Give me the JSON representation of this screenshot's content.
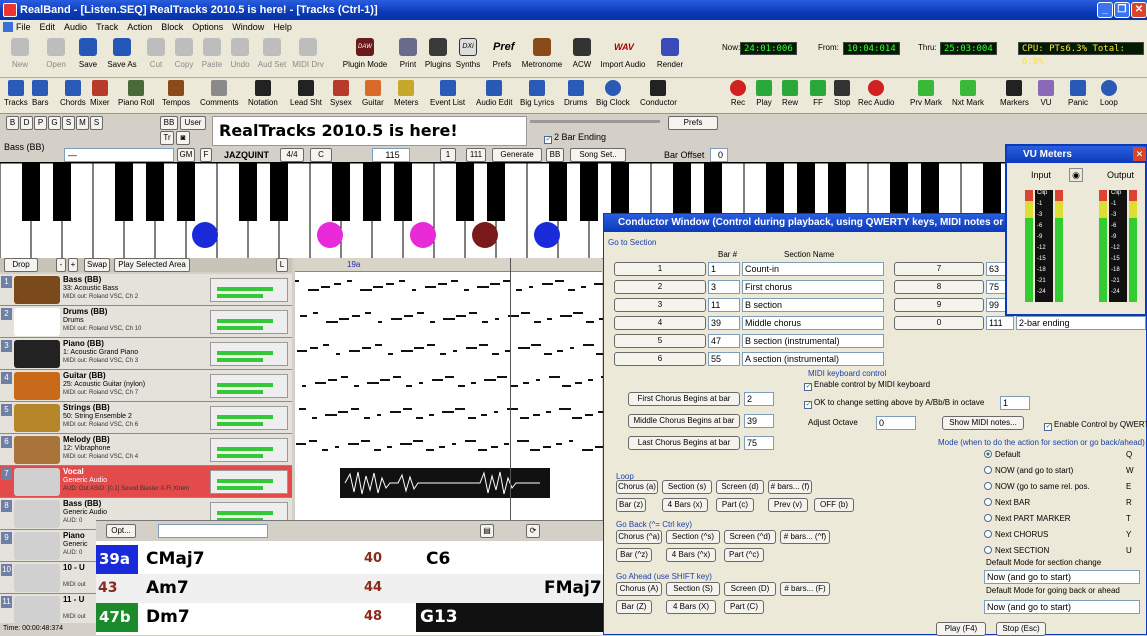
{
  "window": {
    "title": "RealBand - [Listen.SEQ]    RealTracks 2010.5 is here! - [Tracks (Ctrl-1)]"
  },
  "menu": [
    "File",
    "Edit",
    "Audio",
    "Track",
    "Action",
    "Block",
    "Options",
    "Window",
    "Help"
  ],
  "toolbar1": {
    "buttons": [
      "New",
      "Open",
      "Save",
      "Save As",
      "Cut",
      "Copy",
      "Paste",
      "Undo",
      "Aud Set",
      "MIDI Drv",
      "Plugin Mode",
      "Print",
      "Plugins",
      "Synths",
      "Prefs",
      "Metronome",
      "ACW",
      "Import Audio",
      "Render"
    ],
    "daw_badge": "DAW",
    "dx_badge": "DXi",
    "pref_text": "Pref",
    "wav_text": "WAV",
    "now_label": "Now:",
    "now_value": "24:01:006",
    "from_label": "From:",
    "from_value": "10:04:014",
    "thru_label": "Thru:",
    "thru_value": "25:03:004",
    "cpu": "CPU: PTs6.3% Total: 6.8%"
  },
  "toolbar2": {
    "buttons": [
      "Tracks",
      "Bars",
      "Chords",
      "Mixer",
      "Piano Roll",
      "Tempos",
      "Comments",
      "Notation",
      "Lead Sht",
      "Sysex",
      "Guitar",
      "Meters",
      "Event List",
      "Audio Edit",
      "Big Lyrics",
      "Drums",
      "Big Clock",
      "Conductor"
    ],
    "transport": [
      "Rec",
      "Play",
      "Rew",
      "FF",
      "Stop",
      "Rec Audio",
      "Prv Mark",
      "Nxt Mark",
      "Markers",
      "VU",
      "Panic",
      "Loop"
    ]
  },
  "upper": {
    "letter_buttons": [
      "B",
      "D",
      "P",
      "G",
      "S",
      "M",
      "S"
    ],
    "bb_btn": "BB",
    "user_btn": "User",
    "tr_btn": "Tr",
    "banner": "RealTracks 2010.5 is here!",
    "prefs_btn": "Prefs",
    "two_bar_ending": "2 Bar Ending",
    "bass_label": "Bass  (BB)",
    "gm_btn": "GM",
    "f_btn": "F",
    "style": "JAZQUINT",
    "timesig": "4/4",
    "key": "C",
    "tempo": "115",
    "start_bar": "1",
    "end_bar": "111",
    "generate_btn": "Generate",
    "bb_btn2": "BB",
    "song_set_btn": "Song Set..",
    "bar_offset_label": "Bar Offset",
    "bar_offset_value": "0"
  },
  "tracks_panel": {
    "drop_btn": "Drop",
    "swap_btn": "Swap",
    "play_area_btn": "Play Selected Area",
    "l_btn": "L",
    "bar_marker": "19a",
    "tracks": [
      {
        "num": "1",
        "name": "Bass   (BB)",
        "inst": "33: Acoustic Bass",
        "out": "MIDI out: Roland VSC, Ch 2"
      },
      {
        "num": "2",
        "name": "Drums  (BB)",
        "inst": "Drums",
        "out": "MIDI out: Roland VSC, Ch 10"
      },
      {
        "num": "3",
        "name": "Piano  (BB)",
        "inst": "1: Acoustic Grand Piano",
        "out": "MIDI out: Roland VSC, Ch 3"
      },
      {
        "num": "4",
        "name": "Guitar  (BB)",
        "inst": "25: Acoustic Guitar (nylon)",
        "out": "MIDI out: Roland VSC, Ch 7"
      },
      {
        "num": "5",
        "name": "Strings  (BB)",
        "inst": "50: String Ensemble 2",
        "out": "MIDI out: Roland VSC, Ch 6"
      },
      {
        "num": "6",
        "name": "Melody  (BB)",
        "inst": "12: Vibraphone",
        "out": "MIDI out: Roland VSC, Ch 4"
      },
      {
        "num": "7",
        "name": "Vocal",
        "inst": "Generic Audio",
        "out": "AUD: Out ASIO: [0,1] Sound Blaster X-Fi Xtrem"
      },
      {
        "num": "8",
        "name": "Bass   (BB)",
        "inst": "Generic Audio",
        "out": "AUD: 0"
      },
      {
        "num": "9",
        "name": "Piano",
        "inst": "Generic",
        "out": "AUD: 0"
      },
      {
        "num": "10",
        "name": "10 - U",
        "inst": "",
        "out": "MIDI out"
      },
      {
        "num": "11",
        "name": "11 - U",
        "inst": "",
        "out": "MIDI out"
      }
    ]
  },
  "chord_sheet": {
    "opt_btn": "Opt...",
    "rows": [
      {
        "bar1": "39a",
        "chord1": "CMaj7",
        "bar2": "40",
        "chord2": "C6",
        "extra": ""
      },
      {
        "bar1": "43",
        "chord1": "Am7",
        "bar2": "44",
        "chord2": "",
        "extra": "FMaj7"
      },
      {
        "bar1": "47b",
        "chord1": "Dm7",
        "bar2": "48",
        "chord2": "G13",
        "extra": ""
      }
    ]
  },
  "status": {
    "time": "Time: 00:00:48:374"
  },
  "conductor": {
    "title": "Conductor Window (Control during playback, using QWERTY keys, MIDI notes or buttons)",
    "goto_label": "Go to Section",
    "bar_header": "Bar #",
    "section_header": "Section Name",
    "sections_left": [
      {
        "btn": "1",
        "bar": "1",
        "name": "Count-in"
      },
      {
        "btn": "2",
        "bar": "3",
        "name": "First chorus"
      },
      {
        "btn": "3",
        "bar": "11",
        "name": "B section"
      },
      {
        "btn": "4",
        "bar": "39",
        "name": "Middle chorus"
      },
      {
        "btn": "5",
        "bar": "47",
        "name": "B section (instrumental)"
      },
      {
        "btn": "6",
        "bar": "55",
        "name": "A section (instrumental)"
      }
    ],
    "sections_right": [
      {
        "btn": "7",
        "bar": "63",
        "name": ""
      },
      {
        "btn": "8",
        "bar": "75",
        "name": ""
      },
      {
        "btn": "9",
        "bar": "99",
        "name": ""
      },
      {
        "btn": "0",
        "bar": "111",
        "name": "2-bar ending"
      }
    ],
    "first_chorus_btn": "First Chorus Begins at bar",
    "first_chorus_val": "2",
    "middle_chorus_btn": "Middle Chorus Begins at bar",
    "middle_chorus_val": "39",
    "last_chorus_btn": "Last Chorus Begins at bar",
    "last_chorus_val": "75",
    "midi_label": "MIDI keyboard control",
    "enable_midi": "Enable control by MIDI keyboard",
    "ok_change": "OK to change setting above by A/Bb/B in octave",
    "octave_val": "1",
    "adjust_octave": "Adjust Octave",
    "adjust_val": "0",
    "show_midi_btn": "Show MIDI notes...",
    "enable_qwerty": "Enable Control by QWERTY",
    "mode_label": "Mode (when to do the action for section or go back/ahead)",
    "modes": [
      {
        "label": "Default",
        "key": "Q",
        "selected": true
      },
      {
        "label": "NOW (and go to start)",
        "key": "W",
        "selected": false
      },
      {
        "label": "NOW (go to same rel. pos.",
        "key": "E",
        "selected": false
      },
      {
        "label": "Next BAR",
        "key": "R",
        "selected": false
      },
      {
        "label": "Next PART MARKER",
        "key": "T",
        "selected": false
      },
      {
        "label": "Next CHORUS",
        "key": "Y",
        "selected": false
      },
      {
        "label": "Next SECTION",
        "key": "U",
        "selected": false
      }
    ],
    "default_section_label": "Default Mode for section change",
    "default_section_val": "Now (and go to start)",
    "default_back_label": "Default Mode for going back or ahead",
    "default_back_val": "Now (and go to start)",
    "loop_label": "Loop",
    "loop_btns": [
      "Chorus (a)",
      "Section (s)",
      "Screen (d)",
      "# bars... (f)",
      "Bar (z)",
      "4 Bars (x)",
      "Part (c)",
      "Prev (v)",
      "OFF (b)"
    ],
    "goback_label": "Go Back  (^= Ctrl key)",
    "goback_btns": [
      "Chorus (^a)",
      "Section (^s)",
      "Screen (^d)",
      "# bars... (^f)",
      "Bar (^z)",
      "4 Bars (^x)",
      "Part (^c)"
    ],
    "goahead_label": "Go Ahead  (use SHIFT key)",
    "goahead_btns": [
      "Chorus (A)",
      "Section (S)",
      "Screen (D)",
      "# bars... (F)",
      "Bar (Z)",
      "4 Bars (X)",
      "Part (C)"
    ],
    "play_btn": "Play (F4)",
    "stop_btn": "Stop (Esc)"
  },
  "vu": {
    "title": "VU Meters",
    "input": "Input",
    "output": "Output",
    "scale": [
      "Clip",
      "-1",
      "-3",
      "-6",
      "-9",
      "-12",
      "-15",
      "-18",
      "-21",
      "-24"
    ]
  }
}
